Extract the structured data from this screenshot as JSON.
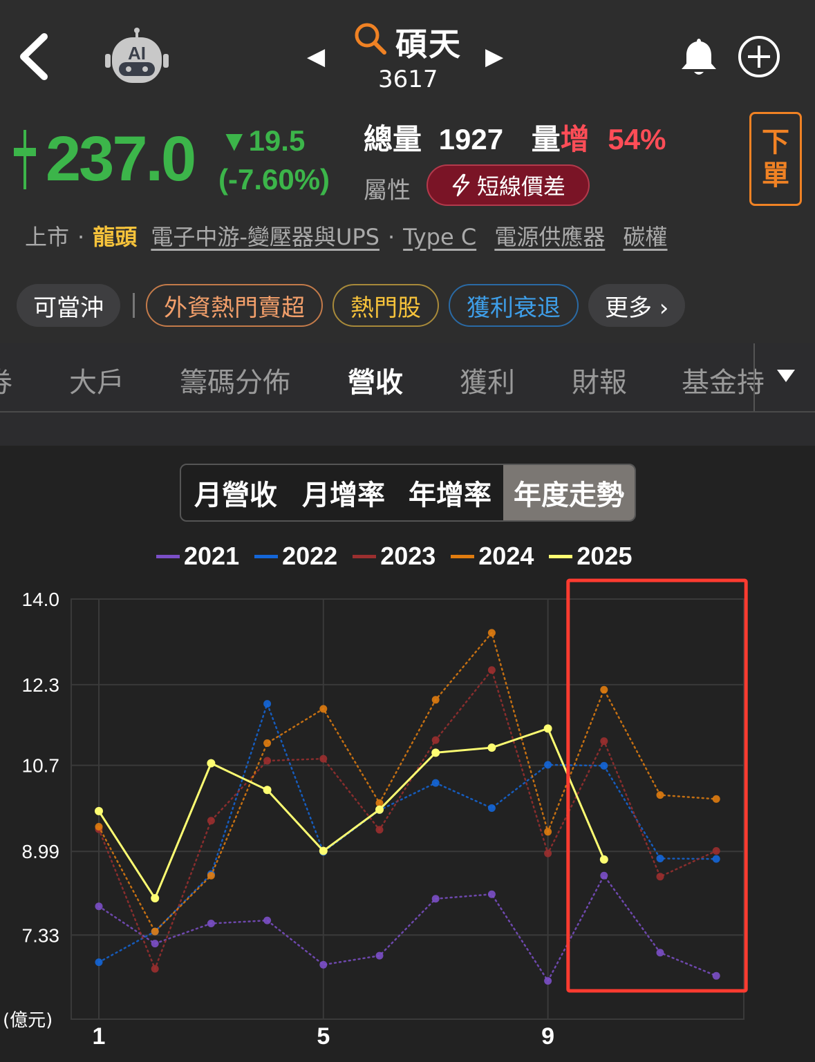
{
  "header": {
    "stock_name": "碩天",
    "stock_code": "3617",
    "ai_label": "AI"
  },
  "quote": {
    "price": "237.0",
    "change": "▼19.5",
    "change_pct": "(-7.60%)",
    "volume_label": "總量",
    "volume_value": "1927",
    "vol_inc_label_a": "量",
    "vol_inc_label_b": "增",
    "vol_inc_value": "54%",
    "attr_label": "屬性",
    "attr_badge": "短線價差",
    "order_button_line1": "下",
    "order_button_line2": "單",
    "color_down": "#3cb54a",
    "color_up": "#ff4d57"
  },
  "categories": {
    "market": "上市",
    "lead": "龍頭",
    "items": [
      "電子中游-變壓器與UPS",
      "Type C",
      "電源供應器",
      "碳權"
    ]
  },
  "tags": {
    "plain": "可當沖",
    "items": [
      {
        "label": "外資熱門賣超",
        "style": "orange"
      },
      {
        "label": "熱門股",
        "style": "yellow"
      },
      {
        "label": "獲利衰退",
        "style": "blue"
      }
    ],
    "more": "更多 ›"
  },
  "subnav": {
    "items": [
      "券",
      "大戶",
      "籌碼分佈",
      "營收",
      "獲利",
      "財報",
      "基金持"
    ],
    "active_index": 3
  },
  "segments": {
    "items": [
      "月營收",
      "月增率",
      "年增率",
      "年度走勢"
    ],
    "active_index": 3
  },
  "chart_data": {
    "type": "line",
    "x": [
      1,
      2,
      3,
      4,
      5,
      6,
      7,
      8,
      9,
      10,
      11,
      12
    ],
    "xticks": [
      "1",
      "5",
      "9"
    ],
    "yticks": [
      "14.0",
      "12.3",
      "10.7",
      "8.99",
      "7.33"
    ],
    "ylabel": "(億元)",
    "ylim": [
      5.66,
      14.0
    ],
    "legend_position": "top",
    "highlight_months": [
      10,
      12
    ],
    "series": [
      {
        "name": "2021",
        "color": "#7b4fc7",
        "values": [
          7.9,
          7.16,
          7.56,
          7.62,
          6.74,
          6.92,
          8.05,
          8.14,
          6.42,
          8.51,
          6.98,
          6.52
        ]
      },
      {
        "name": "2022",
        "color": "#1466d8",
        "values": [
          6.79,
          7.4,
          8.54,
          11.92,
          8.98,
          9.81,
          10.35,
          9.85,
          10.71,
          10.69,
          8.85,
          8.84
        ]
      },
      {
        "name": "2023",
        "color": "#9b2f2f",
        "values": [
          9.43,
          6.66,
          9.6,
          10.79,
          10.83,
          9.42,
          11.2,
          12.59,
          8.95,
          11.18,
          8.49,
          9.0
        ]
      },
      {
        "name": "2024",
        "color": "#e07c0f",
        "values": [
          9.48,
          7.4,
          8.51,
          11.14,
          11.82,
          9.95,
          12.0,
          13.33,
          9.38,
          12.2,
          10.11,
          10.03
        ]
      },
      {
        "name": "2025",
        "color": "#fdfd72",
        "values": [
          9.79,
          8.06,
          10.74,
          10.21,
          9.0,
          9.82,
          10.95,
          11.05,
          11.43,
          8.83
        ]
      }
    ]
  }
}
